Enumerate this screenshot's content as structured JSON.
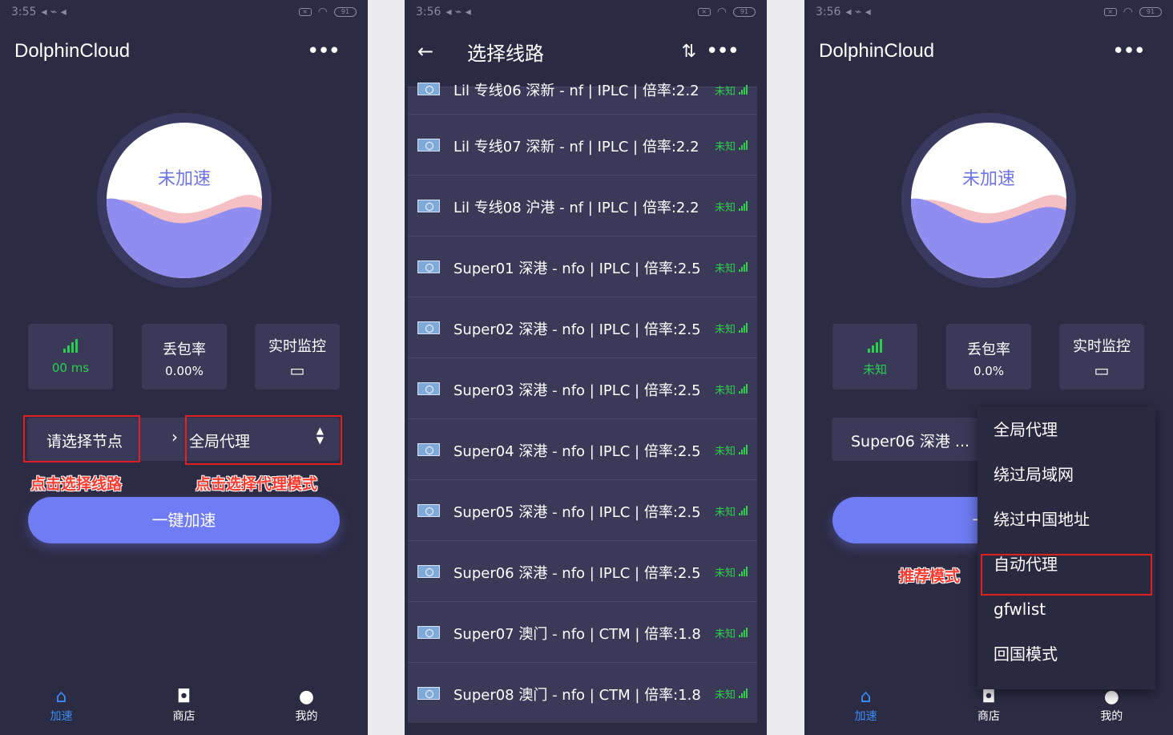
{
  "status": {
    "p1_time": "3:55",
    "p2_time": "3:56",
    "p3_time": "3:56",
    "battery": "91"
  },
  "panel1": {
    "title": "DolphinCloud",
    "gauge_text": "未加速",
    "latency": "00 ms",
    "loss_label": "丢包率",
    "loss_value": "0.00%",
    "monitor_label": "实时监控",
    "node_placeholder": "请选择节点",
    "mode": "全局代理",
    "annotation_node": "点击选择线路",
    "annotation_mode": "点击选择代理模式",
    "primary_button": "一键加速"
  },
  "nav": {
    "speed": "加速",
    "shop": "商店",
    "mine": "我的"
  },
  "panel2": {
    "title": "选择线路",
    "rows": [
      {
        "name": "Lil 专线06 深新 - nf | IPLC | 倍率:2.2",
        "status": "未知"
      },
      {
        "name": "Lil 专线07 深新 - nf | IPLC | 倍率:2.2",
        "status": "未知"
      },
      {
        "name": "Lil 专线08 沪港 - nf | IPLC | 倍率:2.2",
        "status": "未知"
      },
      {
        "name": "Super01 深港 - nfo | IPLC | 倍率:2.5",
        "status": "未知"
      },
      {
        "name": "Super02 深港 - nfo | IPLC | 倍率:2.5",
        "status": "未知"
      },
      {
        "name": "Super03 深港 - nfo | IPLC | 倍率:2.5",
        "status": "未知"
      },
      {
        "name": "Super04 深港 - nfo | IPLC | 倍率:2.5",
        "status": "未知"
      },
      {
        "name": "Super05 深港 - nfo | IPLC | 倍率:2.5",
        "status": "未知"
      },
      {
        "name": "Super06 深港 - nfo | IPLC | 倍率:2.5",
        "status": "未知"
      },
      {
        "name": "Super07 澳门 - nfo | CTM | 倍率:1.8",
        "status": "未知"
      },
      {
        "name": "Super08 澳门 - nfo | CTM | 倍率:1.8",
        "status": "未知"
      }
    ]
  },
  "panel3": {
    "title": "DolphinCloud",
    "gauge_text": "未加速",
    "latency": "未知",
    "loss_label": "丢包率",
    "loss_value": "0.0%",
    "monitor_label": "实时监控",
    "node": "Super06 深港 ...",
    "primary_partial": "一键",
    "annotation": "推荐模式",
    "menu": [
      "全局代理",
      "绕过局域网",
      "绕过中国地址",
      "自动代理",
      "gfwlist",
      "回国模式"
    ]
  },
  "colors": {
    "bg": "#2c2b44",
    "card": "#3a3958",
    "accent": "#6f7cf3",
    "green": "#28d04e",
    "red": "#e01f1f",
    "active_nav": "#3a8df5"
  }
}
